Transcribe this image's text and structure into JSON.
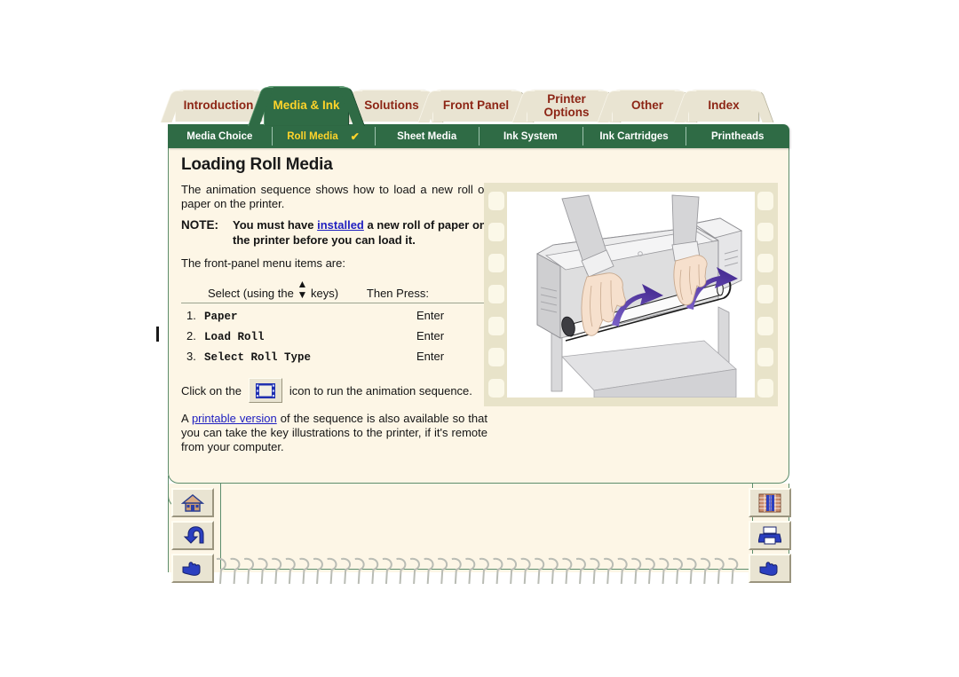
{
  "tabs": {
    "items": [
      {
        "label": "Introduction",
        "active": false
      },
      {
        "label": "Media & Ink",
        "active": true
      },
      {
        "label": "Solutions",
        "active": false
      },
      {
        "label": "Front Panel",
        "active": false
      },
      {
        "label": "Printer\nOptions",
        "active": false
      },
      {
        "label": "Other",
        "active": false
      },
      {
        "label": "Index",
        "active": false
      }
    ]
  },
  "subtabs": {
    "items": [
      {
        "label": "Media Choice",
        "current": false,
        "check": ""
      },
      {
        "label": "Roll Media",
        "current": true,
        "check": "✔"
      },
      {
        "label": "Sheet Media",
        "current": false,
        "check": ""
      },
      {
        "label": "Ink System",
        "current": false,
        "check": ""
      },
      {
        "label": "Ink Cartridges",
        "current": false,
        "check": ""
      },
      {
        "label": "Printheads",
        "current": false,
        "check": ""
      }
    ]
  },
  "page": {
    "title": "Loading Roll Media",
    "intro": "The animation sequence shows how to load a new roll of paper on the printer.",
    "note_label": "NOTE:",
    "note_part1": "You must have ",
    "note_link": "installed",
    "note_part2": " a new roll of paper on the printer before you can load it.",
    "menu_intro": "The front-panel menu items are:",
    "table": {
      "select_header": "Select (using the",
      "select_header_tail": "keys)",
      "press_header": "Then Press:",
      "rows": [
        {
          "num": "1.",
          "item": "Paper",
          "press": "Enter"
        },
        {
          "num": "2.",
          "item": "Load Roll",
          "press": "Enter"
        },
        {
          "num": "3.",
          "item": "Select Roll Type",
          "press": "Enter"
        }
      ]
    },
    "click_prefix": "Click on the",
    "click_suffix": "icon to run the animation sequence.",
    "printable_prefix": "A ",
    "printable_link": "printable version",
    "printable_suffix": " of the sequence is also available so that you can take the key illustrations to the printer, if it's remote from your computer."
  },
  "illustration": {
    "alt": "Hands rotating a paper roll onto the printer spindle",
    "frame_color": "#e8e3c9"
  },
  "nav": {
    "left": [
      {
        "name": "home",
        "label": "Home"
      },
      {
        "name": "back",
        "label": "Back"
      },
      {
        "name": "forward",
        "label": "Forward"
      }
    ],
    "right": [
      {
        "name": "bookshelf",
        "label": "Library"
      },
      {
        "name": "print",
        "label": "Print"
      },
      {
        "name": "forward",
        "label": "Forward"
      }
    ]
  },
  "colors": {
    "green": "#2f6b45",
    "accent_yellow": "#ffd42a",
    "tab_cream": "#e9e4d2",
    "tab_text_red": "#8d2616",
    "page_cream": "#fdf6e6",
    "link_blue": "#2020c0"
  }
}
